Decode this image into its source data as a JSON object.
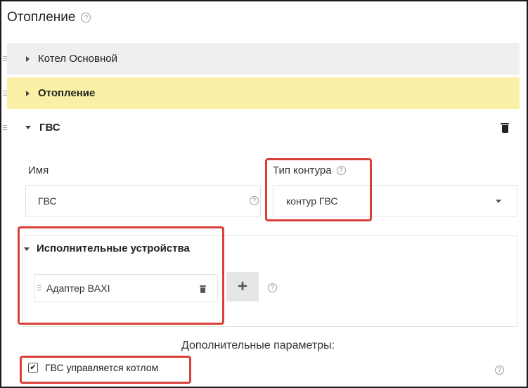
{
  "section": {
    "title": "Отопление"
  },
  "circuits": [
    {
      "label": "Котел Основной"
    },
    {
      "label": "Отопление"
    },
    {
      "label": "ГВС"
    }
  ],
  "form": {
    "name_label": "Имя",
    "name_value": "ГВС",
    "circuit_type_label": "Тип контура",
    "circuit_type_value": "контур ГВС"
  },
  "actuators": {
    "title": "Исполнительные устройства",
    "items": [
      {
        "label": "Адаптер BAXI"
      }
    ],
    "add_label": "+"
  },
  "extra": {
    "title": "Дополнительные параметры:",
    "option_label": "ГВС управляется котлом",
    "option_checked": true
  },
  "icons": {
    "help": "?",
    "check": "✔"
  },
  "colors": {
    "highlight_row": "#faf0a6",
    "collapsed_row": "#efefef",
    "annotation": "#d9403a"
  }
}
